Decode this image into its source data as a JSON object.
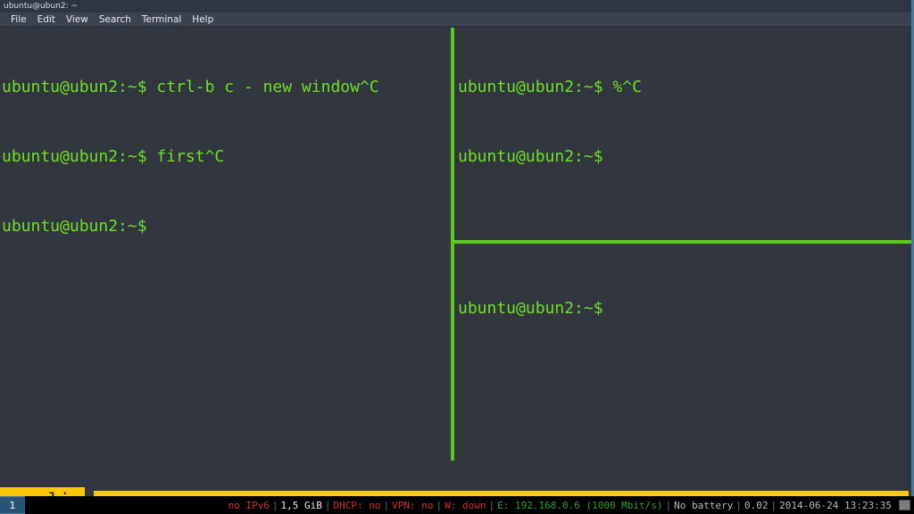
{
  "window": {
    "title": "ubuntu@ubun2: ~",
    "menu": [
      {
        "label": "File"
      },
      {
        "label": "Edit"
      },
      {
        "label": "View"
      },
      {
        "label": "Search"
      },
      {
        "label": "Terminal"
      },
      {
        "label": "Help"
      }
    ]
  },
  "colors": {
    "terminal_background": "#32363f",
    "terminal_foreground": "#6ee023",
    "pane_divider": "#5fc61d",
    "command_line": "#fbc707",
    "command_text": "#2b2b14",
    "titlebar_background": "#2f3541",
    "menubar_background": "#3c4250",
    "window_border": "#4c7899",
    "statusbar_background": "#000000",
    "workspace_active": "#285577"
  },
  "panes": {
    "left": {
      "lines": [
        "ubuntu@ubun2:~$ ctrl-b c - new window^C",
        "ubuntu@ubun2:~$ first^C",
        "ubuntu@ubun2:~$"
      ]
    },
    "top_right": {
      "lines": [
        "ubuntu@ubun2:~$ %^C",
        "ubuntu@ubun2:~$"
      ]
    },
    "bottom_right": {
      "lines": [
        "ubuntu@ubun2:~$"
      ]
    }
  },
  "command_prompt": {
    "text": ": splig"
  },
  "statusbar": {
    "workspaces": [
      {
        "label": "1",
        "active": true
      }
    ],
    "segments": [
      {
        "text": "no IPv6",
        "color": "red"
      },
      {
        "text": "|",
        "color": "sep"
      },
      {
        "text": "1,5 GiB",
        "color": "white"
      },
      {
        "text": "|",
        "color": "sep"
      },
      {
        "text": "DHCP: no",
        "color": "red"
      },
      {
        "text": "|",
        "color": "sep"
      },
      {
        "text": "VPN: no",
        "color": "red"
      },
      {
        "text": "|",
        "color": "sep"
      },
      {
        "text": "W: down",
        "color": "red"
      },
      {
        "text": "|",
        "color": "sep"
      },
      {
        "text": "E: 192.168.0.6 (1000 Mbit/s)",
        "color": "green"
      },
      {
        "text": "|",
        "color": "sep"
      },
      {
        "text": "No battery",
        "color": "white"
      },
      {
        "text": "|",
        "color": "sep"
      },
      {
        "text": "0.02",
        "color": "white"
      },
      {
        "text": "|",
        "color": "sep"
      },
      {
        "text": "2014-06-24 13:23:35",
        "color": "white"
      }
    ],
    "tray_icon": "tray-icon"
  }
}
